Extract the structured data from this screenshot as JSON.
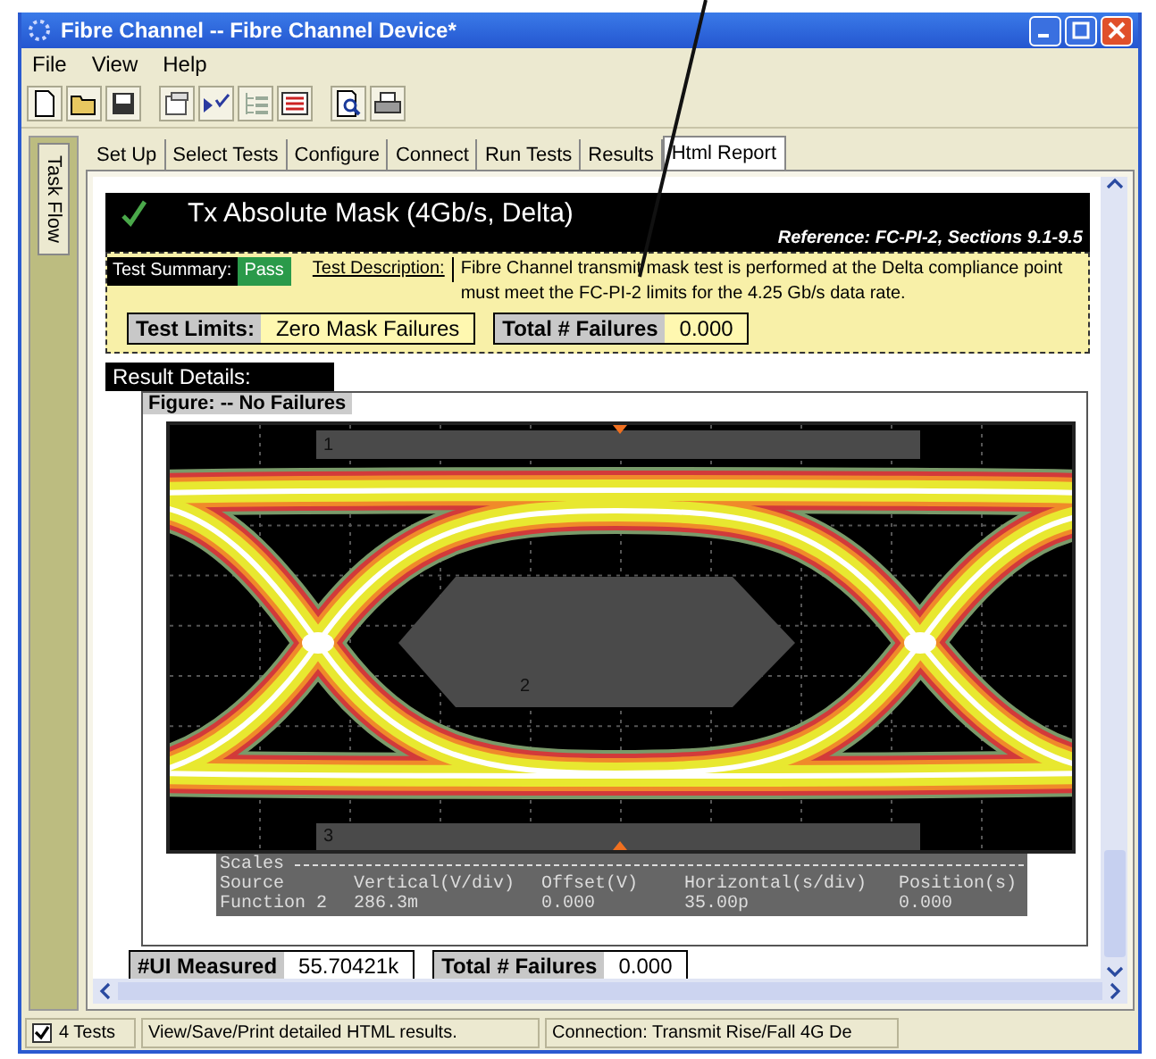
{
  "window": {
    "title": "Fibre Channel -- Fibre Channel Device*"
  },
  "menu": [
    "File",
    "View",
    "Help"
  ],
  "side_tab": {
    "label": "Task Flow"
  },
  "tabs": [
    {
      "label": "Set Up",
      "selected": false
    },
    {
      "label": "Select Tests",
      "selected": false
    },
    {
      "label": "Configure",
      "selected": false
    },
    {
      "label": "Connect",
      "selected": false
    },
    {
      "label": "Run Tests",
      "selected": false
    },
    {
      "label": "Results",
      "selected": false
    },
    {
      "label": "Html Report",
      "selected": true
    }
  ],
  "report": {
    "title": "Tx Absolute Mask (4Gb/s, Delta)",
    "reference": "Reference: FC-PI-2, Sections 9.1-9.5",
    "summary_label": "Test Summary:",
    "result": "Pass",
    "description_label": "Test Description:",
    "description": "Fibre Channel transmit mask test is performed at the Delta compliance point must meet the FC-PI-2 limits for the 4.25 Gb/s data rate.",
    "limits": [
      {
        "label": "Test Limits:",
        "value": "Zero Mask Failures"
      },
      {
        "label": "Total # Failures",
        "value": "0.000"
      }
    ],
    "details_label": "Result Details:",
    "figure_label": "Figure: -- No Failures",
    "mask_labels": [
      "1",
      "2",
      "3"
    ],
    "scales": {
      "title": "Scales",
      "header": [
        "Source",
        "Vertical(V/div)",
        "Offset(V)",
        "Horizontal(s/div)",
        "Position(s)"
      ],
      "row": [
        "Function 2",
        "286.3m",
        "0.000",
        "35.00p",
        "0.000"
      ]
    },
    "measurements": [
      {
        "label": "#UI Measured",
        "value": "55.70421k"
      },
      {
        "label": "Total # Failures",
        "value": "0.000"
      }
    ]
  },
  "status_bar": {
    "tests_checked": true,
    "tests": "4 Tests",
    "message": "View/Save/Print detailed HTML results.",
    "connection": "Connection: Transmit Rise/Fall 4G De"
  }
}
